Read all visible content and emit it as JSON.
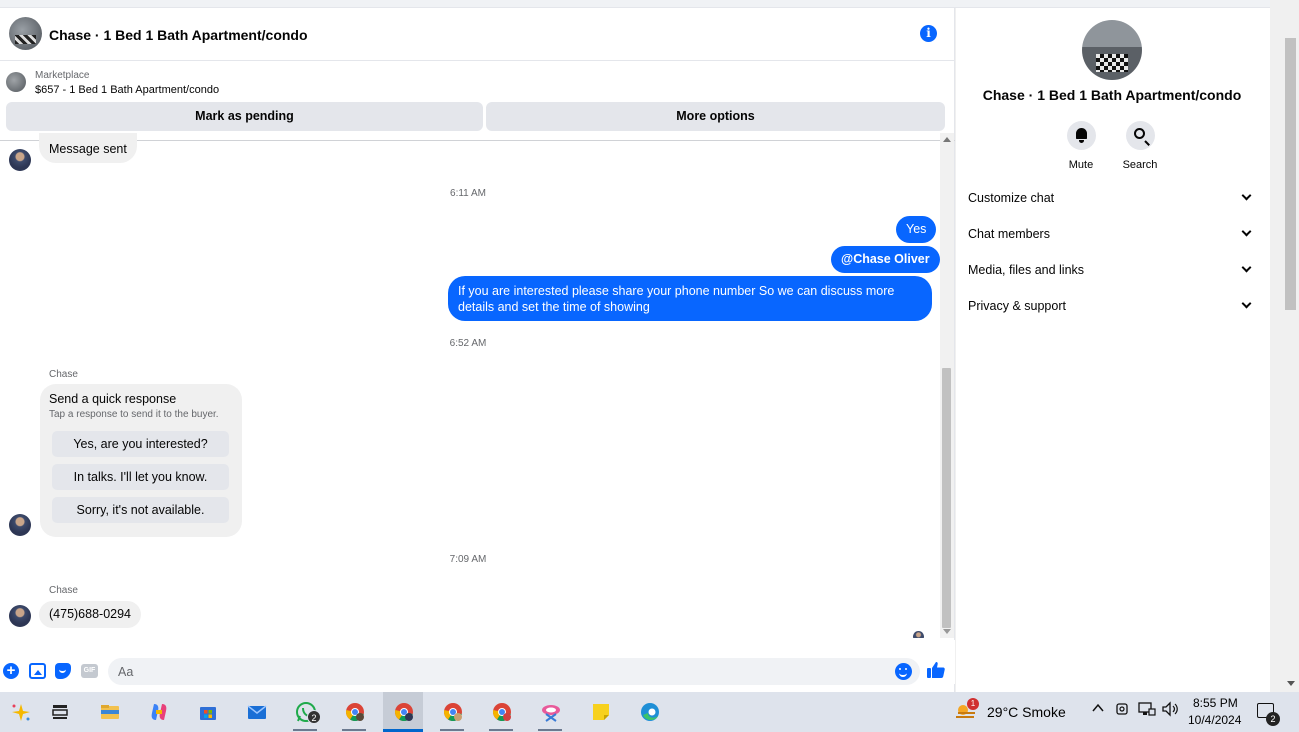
{
  "header": {
    "title": "Chase · 1 Bed 1 Bath Apartment/condo",
    "info_icon": "i"
  },
  "listing": {
    "label": "Marketplace",
    "summary": "$657 - 1 Bed 1 Bath Apartment/condo"
  },
  "actions": {
    "mark_pending": "Mark as pending",
    "more_options": "More options"
  },
  "messages": {
    "first_in": "Message sent",
    "time_1": "6:11 AM",
    "out_1": "Yes",
    "out_2": "@Chase Oliver",
    "out_3": "If you are interested please share your phone number So we can discuss more details and set the time of showing",
    "time_2": "6:52 AM",
    "sender_1": "Chase",
    "quick": {
      "title": "Send a quick response",
      "subtitle": "Tap a response to send it to the buyer.",
      "options": [
        "Yes, are you interested?",
        "In talks. I'll let you know.",
        "Sorry, it's not available."
      ]
    },
    "time_3": "7:09 AM",
    "sender_2": "Chase",
    "last_in": "(475)688-0294"
  },
  "composer": {
    "placeholder": "Aa",
    "gif_label": "GIF",
    "plus": "+"
  },
  "details": {
    "title": "Chase · 1 Bed 1 Bath Apartment/condo",
    "mute_label": "Mute",
    "search_label": "Search",
    "sections": [
      "Customize chat",
      "Chat members",
      "Media, files and links",
      "Privacy & support"
    ]
  },
  "taskbar": {
    "whatsapp_badge": "2",
    "weather_badge": "1",
    "weather": "29°C  Smoke",
    "time": "8:55 PM",
    "date": "10/4/2024",
    "notif_badge": "2"
  },
  "colors": {
    "accent": "#0866ff",
    "bubble_in": "#f0f0f0",
    "button_bg": "#e4e6eb"
  }
}
